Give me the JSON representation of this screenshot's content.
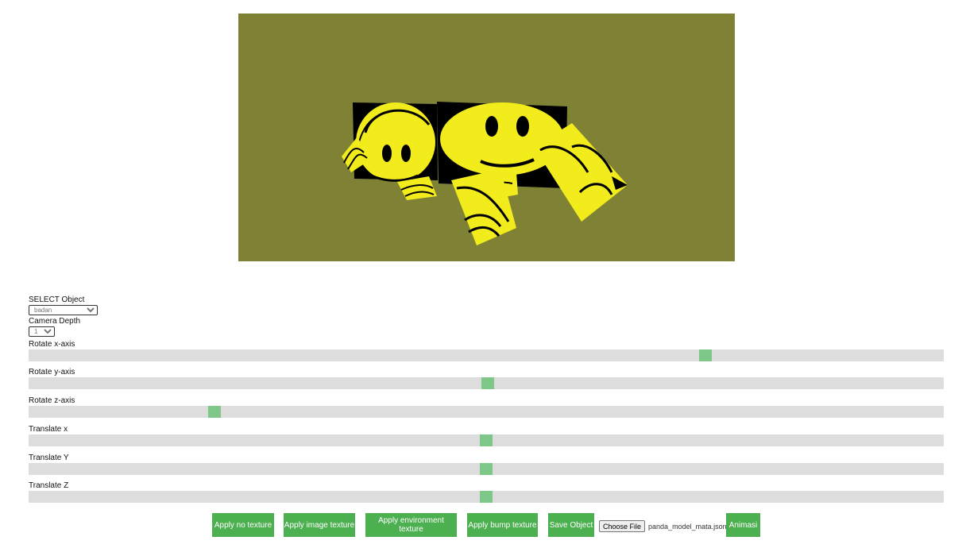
{
  "canvas": {
    "background": "#7f8135",
    "face_color": "#f2ec1c",
    "feature_color": "#000000"
  },
  "controls": {
    "select_object": {
      "label": "SELECT Object",
      "value": "badan"
    },
    "camera_depth": {
      "label": "Camera Depth",
      "value": "1"
    },
    "sliders": [
      {
        "label": "Rotate x-axis",
        "value_fraction": 0.743
      },
      {
        "label": "Rotate y-axis",
        "value_fraction": 0.502
      },
      {
        "label": "Rotate z-axis",
        "value_fraction": 0.199
      },
      {
        "label": "Translate x",
        "value_fraction": 0.5
      },
      {
        "label": "Translate Y",
        "value_fraction": 0.5
      },
      {
        "label": "Translate Z",
        "value_fraction": 0.5
      }
    ],
    "track_color": "#dddddd",
    "thumb_color": "#7fc689"
  },
  "buttons": {
    "apply_no_texture": "Apply no texture",
    "apply_image_texture": "Apply image texture",
    "apply_environment_texture": "Apply environment texture",
    "apply_bump_texture": "Apply bump texture",
    "save_object": "Save Object",
    "choose_file": "Choose File",
    "chosen_file": "panda_model_mata.json",
    "animasi": "Animasi",
    "button_color": "#4caf50"
  }
}
